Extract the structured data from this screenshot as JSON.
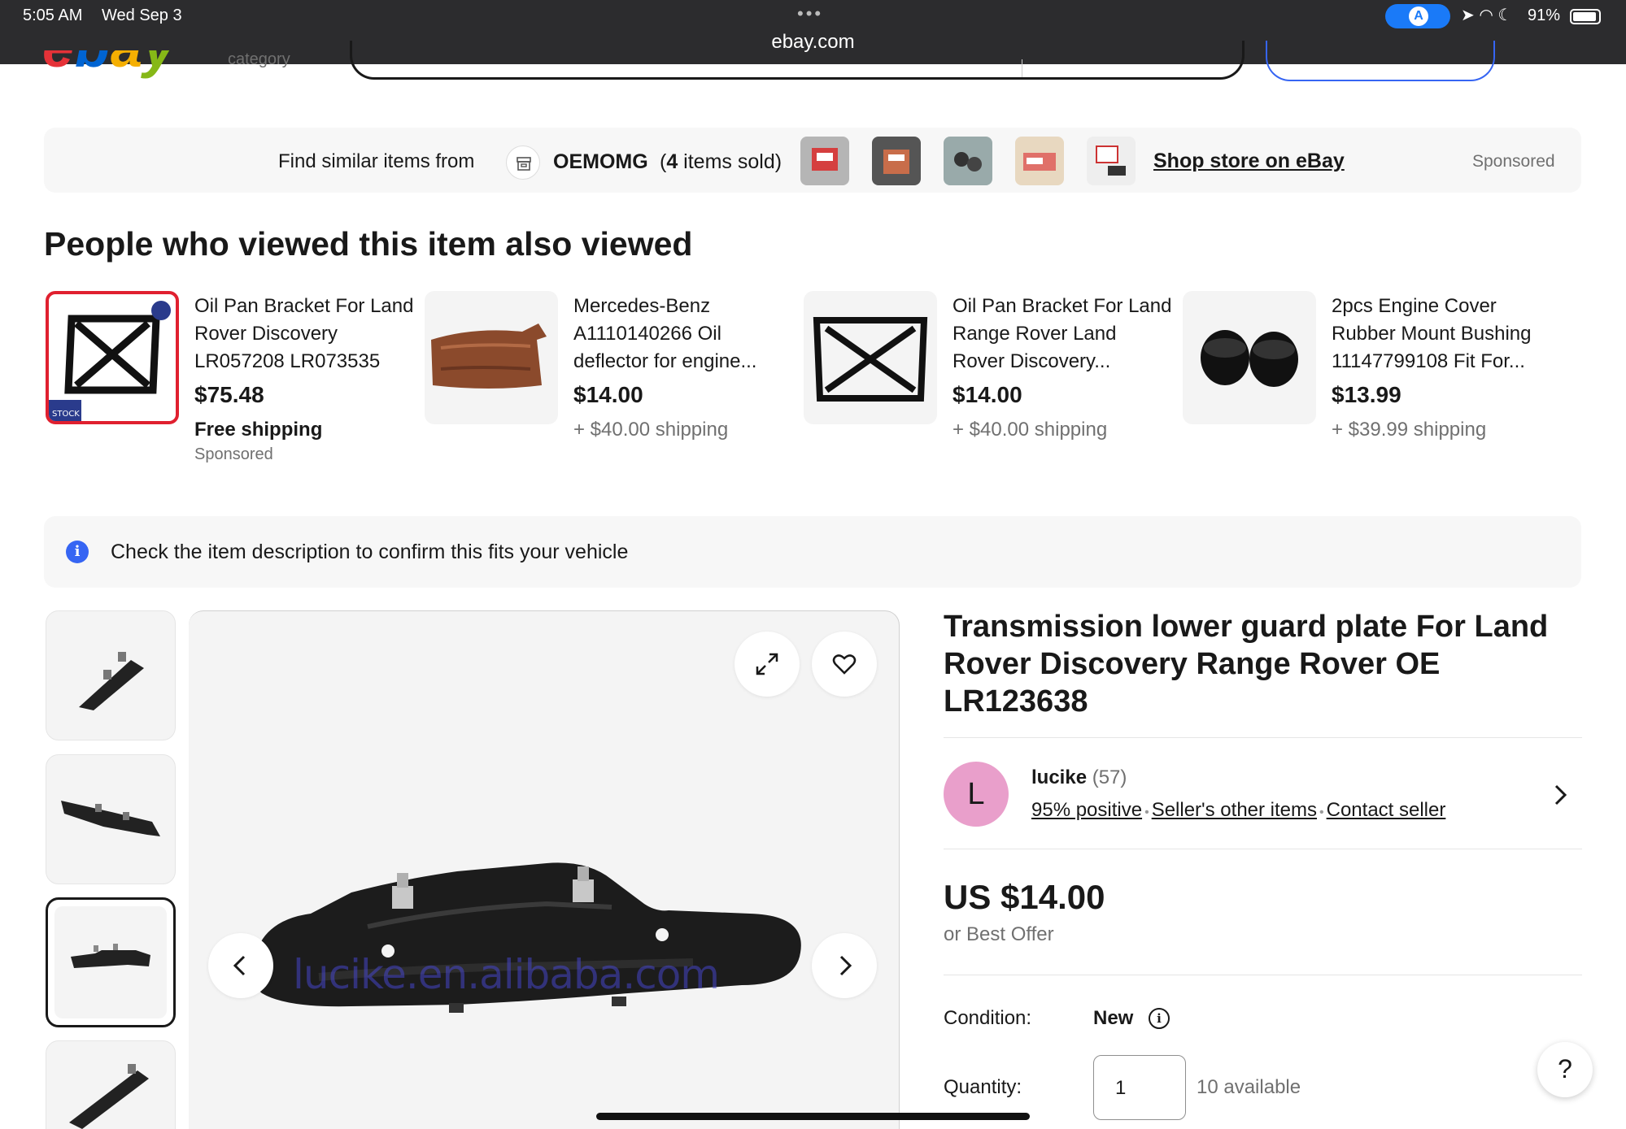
{
  "status_bar": {
    "time": "5:05 AM",
    "date": "Wed Sep 3",
    "url": "ebay.com",
    "battery": "91%"
  },
  "header": {
    "logo": "ebay",
    "category_partial": "category"
  },
  "store_strip": {
    "lead": "Find similar items from",
    "store_name": "OEMOMG",
    "sold_count": "4",
    "sold_prefix": "(",
    "sold_suffix": " items sold)",
    "shop_link": "Shop store on eBay",
    "sponsored": "Sponsored"
  },
  "also_viewed": {
    "title": "People who viewed this item also viewed",
    "items": [
      {
        "title": "Oil Pan Bracket For Land Rover Discovery LR057208 LR073535",
        "price": "$75.48",
        "shipping": "Free shipping",
        "sponsored": "Sponsored"
      },
      {
        "title": "Mercedes-Benz A1110140266 Oil deflector for engine...",
        "price": "$14.00",
        "shipping": "+ $40.00 shipping"
      },
      {
        "title": "Oil Pan Bracket For Land Range Rover Land Rover Discovery...",
        "price": "$14.00",
        "shipping": "+ $40.00 shipping"
      },
      {
        "title": "2pcs Engine Cover Rubber Mount Bushing 11147799108 Fit For...",
        "price": "$13.99",
        "shipping": "+ $39.99 shipping"
      }
    ]
  },
  "fit_notice": {
    "text": "Check the item description to confirm this fits your vehicle"
  },
  "gallery": {
    "watermark": "lucike.en.alibaba.com"
  },
  "item": {
    "title": "Transmission lower guard plate For Land Rover Discovery Range Rover OE LR123638",
    "seller": {
      "initial": "L",
      "name": "lucike",
      "count": "(57)",
      "positive": "95% positive",
      "other_items": "Seller's other items",
      "contact": "Contact seller"
    },
    "price": "US $14.00",
    "best_offer": "or Best Offer",
    "condition_label": "Condition:",
    "condition_value": "New",
    "quantity_label": "Quantity:",
    "quantity_value": "1",
    "available": "10 available"
  },
  "colors": {
    "accent_blue": "#3665f3",
    "avatar_pink": "#e99fcb",
    "status_bar": "#2c2c2e"
  }
}
